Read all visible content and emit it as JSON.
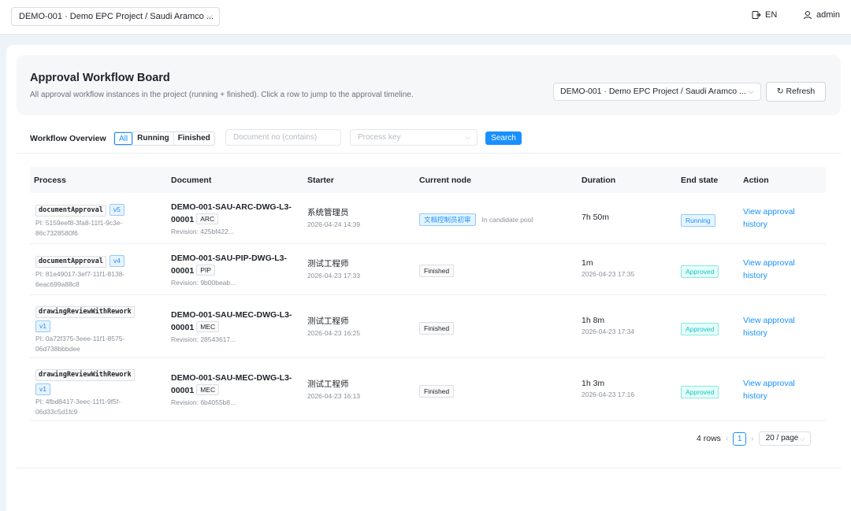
{
  "topbar": {
    "project_select": "DEMO-001 · Demo EPC Project / Saudi Aramco ...",
    "lang": "EN",
    "user": "admin"
  },
  "header": {
    "title": "Approval Workflow Board",
    "subtitle": "All approval workflow instances in the project (running + finished). Click a row to jump to the approval timeline.",
    "project_select": "DEMO-001 · Demo EPC Project / Saudi Aramco ...",
    "refresh_label": "Refresh"
  },
  "filters": {
    "label": "Workflow Overview",
    "segments": [
      "All",
      "Running",
      "Finished"
    ],
    "active_segment": "All",
    "doc_placeholder": "Document no (contains)",
    "process_placeholder": "Process key",
    "search_label": "Search"
  },
  "table": {
    "columns": [
      "Process",
      "Document",
      "Starter",
      "Current node",
      "Duration",
      "End state",
      "Action"
    ],
    "rows": [
      {
        "process_key": "documentApproval",
        "version": "v5",
        "pi": "PI: 5159eef8-3fa8-11f1-9c3e-86c7328580f6",
        "doc_no": "DEMO-001-SAU-ARC-DWG-L3-00001",
        "discipline": "ARC",
        "revision": "Revision: 425bf422...",
        "starter": "系统管理员",
        "start_time": "2026-04-24 14:39",
        "node": "文档控制员初审",
        "node_note": "In candidate pool",
        "duration": "7h 50m",
        "end_time": "",
        "state": "Running",
        "action": "View approval history"
      },
      {
        "process_key": "documentApproval",
        "version": "v4",
        "pi": "PI: 81e49017-3ef7-11f1-8138-6eac699a88c8",
        "doc_no": "DEMO-001-SAU-PIP-DWG-L3-00001",
        "discipline": "PIP",
        "revision": "Revision: 9b00beab...",
        "starter": "测试工程师",
        "start_time": "2026-04-23 17:33",
        "node": "Finished",
        "node_note": "",
        "duration": "1m",
        "end_time": "2026-04-23 17:35",
        "state": "Approved",
        "action": "View approval history"
      },
      {
        "process_key": "drawingReviewWithRework",
        "version": "v1",
        "pi": "PI: 0a72f375-3eee-11f1-8575-06d738bbbdee",
        "doc_no": "DEMO-001-SAU-MEC-DWG-L3-00001",
        "discipline": "MEC",
        "revision": "Revision: 28543617...",
        "starter": "测试工程师",
        "start_time": "2026-04-23 16:25",
        "node": "Finished",
        "node_note": "",
        "duration": "1h 8m",
        "end_time": "2026-04-23 17:34",
        "state": "Approved",
        "action": "View approval history"
      },
      {
        "process_key": "drawingReviewWithRework",
        "version": "v1",
        "pi": "PI: 4fbd8417-3eec-11f1-9f5f-06d33c5d1fc9",
        "doc_no": "DEMO-001-SAU-MEC-DWG-L3-00001",
        "discipline": "MEC",
        "revision": "Revision: 6b4055b8...",
        "starter": "测试工程师",
        "start_time": "2026-04-23 16:13",
        "node": "Finished",
        "node_note": "",
        "duration": "1h 3m",
        "end_time": "2026-04-23 17:16",
        "state": "Approved",
        "action": "View approval history"
      }
    ]
  },
  "pagination": {
    "total": "4 rows",
    "current_page": "1",
    "page_size": "20 / page"
  },
  "colors": {
    "accent": "#1890ff",
    "approved": "#13c2c2"
  }
}
